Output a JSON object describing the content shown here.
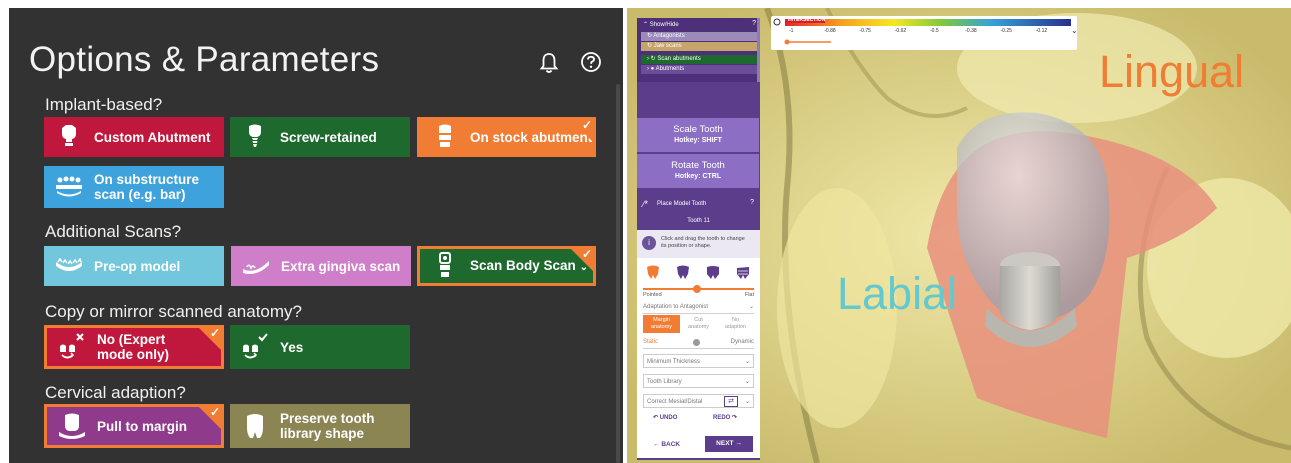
{
  "options": {
    "title": "Options & Parameters",
    "sections": {
      "implant": "Implant-based?",
      "scans": "Additional Scans?",
      "anatomy": "Copy or mirror scanned anatomy?",
      "cervical": "Cervical adaption?"
    },
    "cards": {
      "custom_abutment": "Custom Abutment",
      "screw_retained": "Screw-retained",
      "stock_abutment": "On stock abutment",
      "substructure_line1": "On substructure",
      "substructure_line2": "scan (e.g. bar)",
      "preop_model": "Pre-op model",
      "extra_gingiva": "Extra gingiva scan",
      "scan_body": "Scan Body Scan",
      "no_expert_line1": "No (Expert",
      "no_expert_line2": "mode only)",
      "yes": "Yes",
      "pull_to_margin": "Pull to margin",
      "preserve_line1": "Preserve tooth",
      "preserve_line2": "library shape"
    },
    "colors": {
      "crimson": "#c0183d",
      "green": "#1e6a2e",
      "orange": "#f07d33",
      "blue": "#3ea2dc",
      "cyan": "#72c7dc",
      "pink": "#cf7fc9",
      "purple": "#8f3a8a",
      "khaki": "#8b8453"
    }
  },
  "tool": {
    "showhide": {
      "title": "Show/Hide",
      "antagonists": "Antagonists",
      "jaw_scans": "Jaw scans",
      "scan_abutments": "Scan abutments",
      "abutments": "Abutments"
    },
    "scale_tooth": {
      "label": "Scale Tooth",
      "hotkey": "Hotkey: SHIFT"
    },
    "rotate_tooth": {
      "label": "Rotate Tooth",
      "hotkey": "Hotkey: CTRL"
    },
    "place": {
      "title": "Place Model Tooth",
      "tooth": "Tooth 11",
      "info_line1": "Click and drag the tooth to change",
      "info_line2": "its position or shape.",
      "pointed": "Pointed",
      "flat": "Flat",
      "adaptation": "Adaptation to Antagonist",
      "seg_margin_1": "Margin",
      "seg_margin_2": "anatomy",
      "seg_cut_1": "Cut",
      "seg_cut_2": "anatomy",
      "seg_no_1": "No",
      "seg_no_2": "adaption",
      "static": "Static",
      "dynamic": "Dynamic",
      "min_thickness": "Minimum Thickness",
      "tooth_library": "Tooth Library",
      "correct": "Correct Mesial/Distal",
      "undo": "UNDO",
      "redo": "REDO",
      "back": "BACK",
      "next": "NEXT"
    }
  },
  "legend": {
    "title": "INTERSECTION",
    "ticks": [
      "-1",
      "-0.88",
      "-0.75",
      "-0.62",
      "-0.5",
      "-0.38",
      "-0.25",
      "-0.12"
    ]
  },
  "viewport": {
    "lingual": "Lingual",
    "labial": "Labial",
    "lingual_color": "#f07d33",
    "labial_color": "#63c9cf"
  }
}
